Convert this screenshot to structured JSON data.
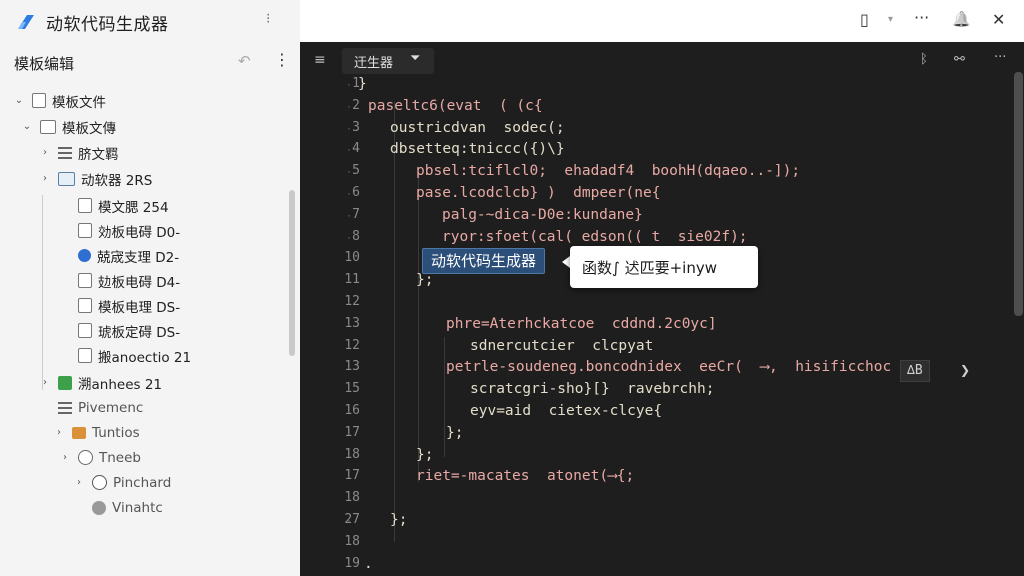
{
  "app": {
    "title": "动软代码生成器",
    "more": "⁝"
  },
  "panel": {
    "title": "模板编辑",
    "undo": "↶",
    "kebab": "⋮"
  },
  "tree": [
    {
      "label": "模板文件",
      "chev": "⌄",
      "icon": "file"
    },
    {
      "label": "模板文傳",
      "chev": "⌄",
      "icon": "folder"
    },
    {
      "label": "脐文羁",
      "chev": "›",
      "icon": "list"
    },
    {
      "label": "动软器 2RS",
      "chev": "›",
      "icon": "folder-blue"
    },
    {
      "label": "模文腮 254",
      "chev": "",
      "icon": "file"
    },
    {
      "label": "効板电碍 D0-",
      "chev": "",
      "icon": "file"
    },
    {
      "label": "兢宬支理 D2-",
      "chev": "",
      "icon": "blue-badge"
    },
    {
      "label": "攰板电碍 D4-",
      "chev": "",
      "icon": "file"
    },
    {
      "label": "模板电理 DS-",
      "chev": "",
      "icon": "file"
    },
    {
      "label": "琥板定碍 DS-",
      "chev": "",
      "icon": "file"
    },
    {
      "label": "搬anoectio 21",
      "chev": "",
      "icon": "file"
    },
    {
      "label": "溯anhees 21",
      "chev": "›",
      "icon": "green"
    },
    {
      "label": "Pivemenc",
      "chev": "",
      "icon": "list"
    },
    {
      "label": "Tuntios",
      "chev": "›",
      "icon": "orange"
    },
    {
      "label": "Tneeb",
      "chev": "›",
      "icon": "circle"
    },
    {
      "label": "Pinchard",
      "chev": "›",
      "icon": "gear"
    },
    {
      "label": "Vinahtc",
      "chev": "",
      "icon": "dot"
    }
  ],
  "topbar": {
    "layout_icon": "▯",
    "caret": "▾",
    "more": "···",
    "bell": "🔔",
    "close": "✕"
  },
  "editor": {
    "menu": "≡",
    "tab_label": "迀生器",
    "tab_filter": "⏷",
    "tools": [
      "ᛒ",
      "⚯",
      "···"
    ],
    "line_numbers": [
      "1",
      "2",
      "3",
      "4",
      "5",
      "6",
      "7",
      "8",
      "10",
      "11",
      "12",
      "13",
      "12",
      "13",
      "15",
      "16",
      "17",
      "18",
      "17",
      "18",
      "27",
      "18",
      "19"
    ],
    "code": [
      "}",
      "paseltc6(evat  ( (c{",
      "oustricdvan  sodec(;",
      "dbsetteq:tniccc({)\\}",
      "pbsel:tciflcl0;  ehadadf4  boohH(dqaeo..-]);",
      "pase.lcodclcb} )  dmpeer(ne{",
      "palg-~dica-D0e:kundane}",
      "ryor:sfoet(cal( edson(( t  sie02f);",
      "",
      "};",
      "",
      "phre=Aterhckatcoe  cddnd.2c0yc]",
      "sdnercutcier  clcpyat",
      "petrle-soudeneg.boncodnidex  eeCr(  ⟶,  hisificchoc",
      "scratcgri-sho}[}  ravebrchh;",
      "eyv=aid  cietex-clcye{",
      "};",
      "};",
      "riet=-macates  atonet(⟶{;",
      "",
      "};",
      "",
      "."
    ],
    "highlight": "动软代码生成器",
    "tooltip": "函数∫ 迖匹要+inyw",
    "suggestion": "∆B"
  }
}
